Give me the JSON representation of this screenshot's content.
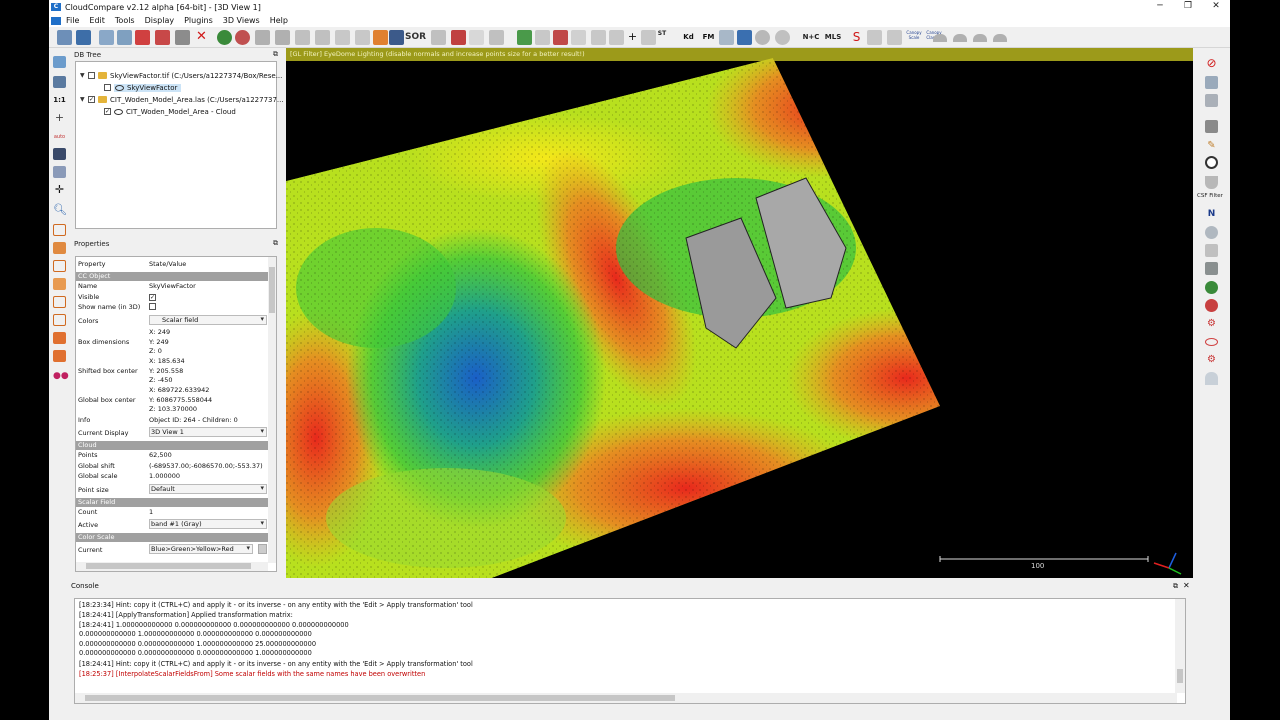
{
  "window": {
    "title": "CloudCompare v2.12 alpha [64-bit] - [3D View 1]",
    "controls": [
      "─",
      "❐",
      "✕"
    ]
  },
  "menu": [
    "File",
    "Edit",
    "Tools",
    "Display",
    "Plugins",
    "3D Views",
    "Help"
  ],
  "toolbar": {
    "sor": "SOR",
    "st": "ST",
    "kd": "Kd",
    "fm": "FM",
    "npc": "N+C",
    "mls": "MLS",
    "scale": "Canopy Scale",
    "classify": "Canopy Classify"
  },
  "left_tools": {
    "one_to_one": "1:1",
    "auto": "auto"
  },
  "db_tree": {
    "title": "DB Tree",
    "items": [
      {
        "label": "SkyViewFactor.tif (C:/Users/a1227374/Box/Rese...",
        "checked": false
      },
      {
        "label": "SkyViewFactor",
        "checked": false,
        "selected": true
      },
      {
        "label": "CIT_Woden_Model_Area.las (C:/Users/a1227737...",
        "checked": true
      },
      {
        "label": "CIT_Woden_Model_Area - Cloud",
        "checked": true
      }
    ]
  },
  "properties": {
    "title": "Properties",
    "header": {
      "k": "Property",
      "v": "State/Value"
    },
    "sections": {
      "cc": "CC Object",
      "cloud": "Cloud",
      "sf": "Scalar Field",
      "cs": "Color Scale"
    },
    "rows": {
      "name": {
        "k": "Name",
        "v": "SkyViewFactor"
      },
      "visible": {
        "k": "Visible",
        "v": "✓"
      },
      "showname": {
        "k": "Show name (in 3D)",
        "v": ""
      },
      "colors": {
        "k": "Colors",
        "v": "Scalar field"
      },
      "box": {
        "k": "Box dimensions",
        "v1": "X: 249",
        "v2": "Y: 249",
        "v3": "Z: 0"
      },
      "shifted": {
        "k": "Shifted box center",
        "v1": "X: 185.634",
        "v2": "Y: 205.558",
        "v3": "Z: -450"
      },
      "global": {
        "k": "Global box center",
        "v1": "X: 689722.633942",
        "v2": "Y: 6086775.558044",
        "v3": "Z: 103.370000"
      },
      "info": {
        "k": "Info",
        "v": "Object ID: 264 - Children: 0"
      },
      "display": {
        "k": "Current Display",
        "v": "3D View 1"
      },
      "points": {
        "k": "Points",
        "v": "62,500"
      },
      "gshift": {
        "k": "Global shift",
        "v": "(-689537.00;-6086570.00;-553.37)"
      },
      "gscale": {
        "k": "Global scale",
        "v": "1.000000"
      },
      "psize": {
        "k": "Point size",
        "v": "Default"
      },
      "count": {
        "k": "Count",
        "v": "1"
      },
      "active": {
        "k": "Active",
        "v": "band #1 (Gray)"
      },
      "current": {
        "k": "Current",
        "v": "Blue>Green>Yellow>Red"
      }
    }
  },
  "view3d": {
    "filter_message": "[GL Filter] EyeDome Lighting (disable normals and increase points size for a better result!)",
    "scale_label": "100"
  },
  "right_panel": {
    "csf": "CSF Filter",
    "north": "N"
  },
  "console": {
    "title": "Console",
    "lines": [
      {
        "text": "[18:23:34] Hint: copy it (CTRL+C) and apply it - or its inverse - on any entity with the 'Edit > Apply transformation' tool",
        "warn": false
      },
      {
        "text": "[18:24:41] [ApplyTransformation] Applied transformation matrix:",
        "warn": false
      },
      {
        "text": "[18:24:41] 1.000000000000 0.000000000000 0.000000000000 0.000000000000",
        "warn": false
      },
      {
        "text": "0.000000000000 1.000000000000 0.000000000000 0.000000000000",
        "warn": false
      },
      {
        "text": "0.000000000000 0.000000000000 1.000000000000 25.000000000000",
        "warn": false
      },
      {
        "text": "0.000000000000 0.000000000000 0.000000000000 1.000000000000",
        "warn": false
      },
      {
        "text": "[18:24:41] Hint: copy it (CTRL+C) and apply it - or its inverse - on any entity with the 'Edit > Apply transformation' tool",
        "warn": false
      },
      {
        "text": "[18:25:37] [InterpolateScalarFieldsFrom] Some scalar fields with the same names have been overwritten",
        "warn": true
      }
    ]
  },
  "colors": {
    "accent": "#1f6fc8",
    "gl_bar": "#9c9a1a",
    "section": "#a0a0a0",
    "warn": "#c00000"
  }
}
